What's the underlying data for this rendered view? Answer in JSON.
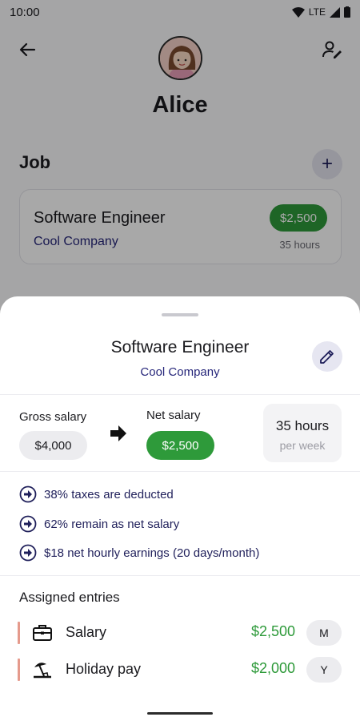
{
  "status_bar": {
    "time": "10:00",
    "network": "LTE"
  },
  "profile": {
    "name": "Alice"
  },
  "job_section": {
    "title": "Job",
    "add_label": "+"
  },
  "job_card": {
    "title": "Software Engineer",
    "company": "Cool Company",
    "net_salary": "$2,500",
    "hours": "35 hours"
  },
  "sheet": {
    "title": "Software Engineer",
    "company": "Cool Company",
    "gross_label": "Gross salary",
    "gross_value": "$4,000",
    "net_label": "Net salary",
    "net_value": "$2,500",
    "hours_value": "35 hours",
    "hours_period": "per week",
    "info": [
      "38% taxes are deducted",
      "62% remain as net salary",
      "$18 net hourly earnings (20 days/month)"
    ],
    "assigned_title": "Assigned entries",
    "entries": [
      {
        "label": "Salary",
        "amount": "$2,500",
        "frequency": "M",
        "icon": "briefcase-icon"
      },
      {
        "label": "Holiday pay",
        "amount": "$2,000",
        "frequency": "Y",
        "icon": "beach-icon"
      }
    ]
  },
  "colors": {
    "accent_green": "#2e9a3a",
    "navy_text": "#26267a",
    "entry_bar": "#e59a8c"
  }
}
